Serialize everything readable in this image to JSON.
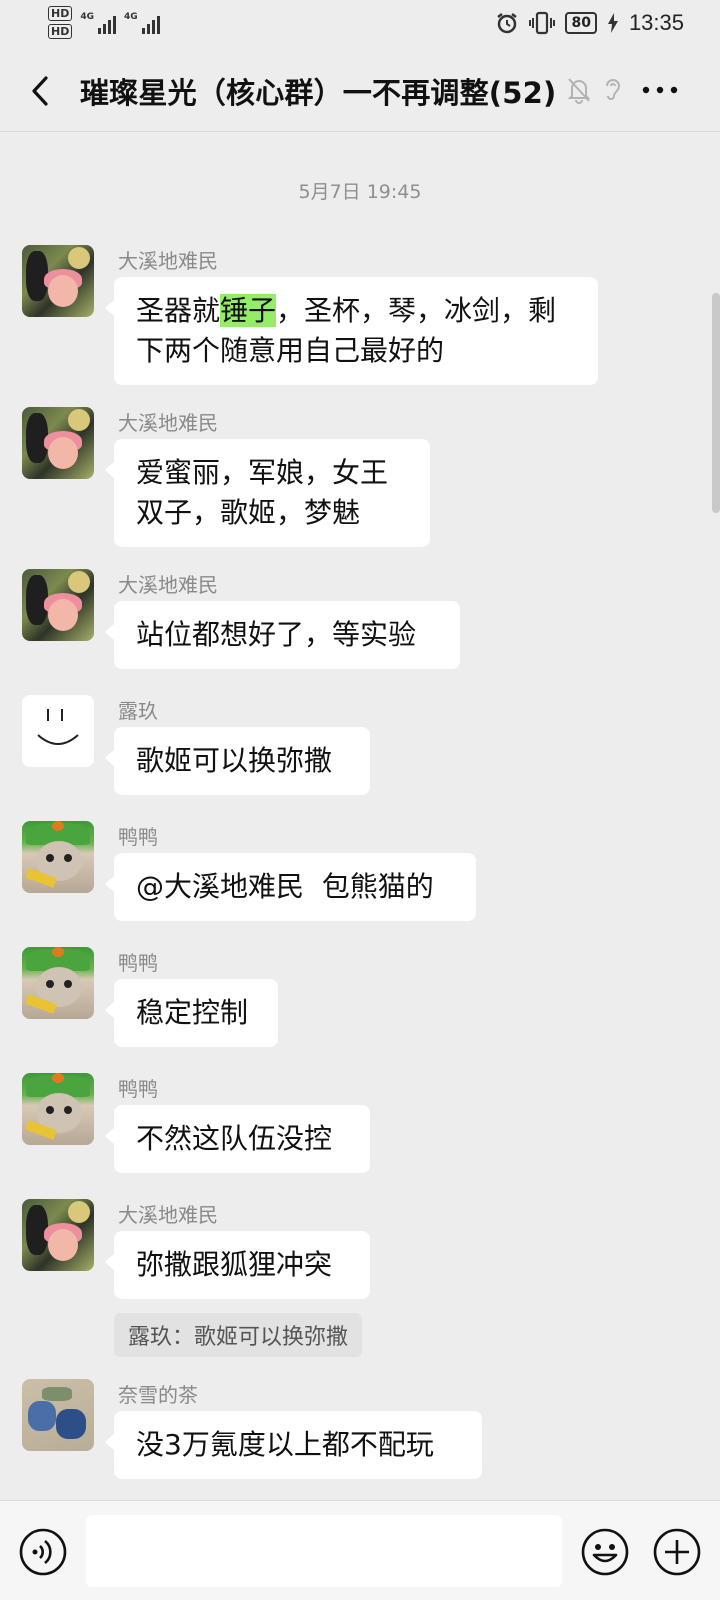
{
  "status_bar": {
    "hd1": "HD",
    "hd2": "HD",
    "net1": "4G",
    "net2": "4G",
    "battery": "80",
    "time": "13:35"
  },
  "header": {
    "title": "璀璨星光（核心群）一不再调整(52)"
  },
  "chat": {
    "timestamp": "5月7日 19:45",
    "messages": [
      {
        "sender": "大溪地难民",
        "pre": "圣器就",
        "hl": "锤子",
        "post": "，圣杯，琴，冰剑，剩",
        "line2": "下两个随意用自己最好的"
      },
      {
        "sender": "大溪地难民",
        "line1": "爱蜜丽，军娘，女王",
        "line2": "双子，歌姬，梦魅"
      },
      {
        "sender": "大溪地难民",
        "text": "站位都想好了，等实验"
      },
      {
        "sender": "露玖",
        "text": "歌姬可以换弥撒"
      },
      {
        "sender": "鸭鸭",
        "text": "@大溪地难民  包熊猫的"
      },
      {
        "sender": "鸭鸭",
        "text": "稳定控制"
      },
      {
        "sender": "鸭鸭",
        "text": "不然这队伍没控"
      },
      {
        "sender": "大溪地难民",
        "text": "弥撒跟狐狸冲突",
        "quote": "露玖：歌姬可以换弥撒"
      },
      {
        "sender": "奈雪的茶",
        "text": "没3万氪度以上都不配玩"
      }
    ]
  },
  "input": {
    "value": "",
    "placeholder": ""
  },
  "icons": {
    "back": "chevron-left-icon",
    "mute": "bell-off-icon",
    "ear": "ear-icon",
    "more": "more-icon",
    "voice": "voice-icon",
    "emoji": "emoji-icon",
    "plus": "plus-icon"
  },
  "colors": {
    "background": "#ededed",
    "bubble": "#ffffff",
    "highlight": "#95ec69",
    "sender": "#8a8a8a"
  }
}
